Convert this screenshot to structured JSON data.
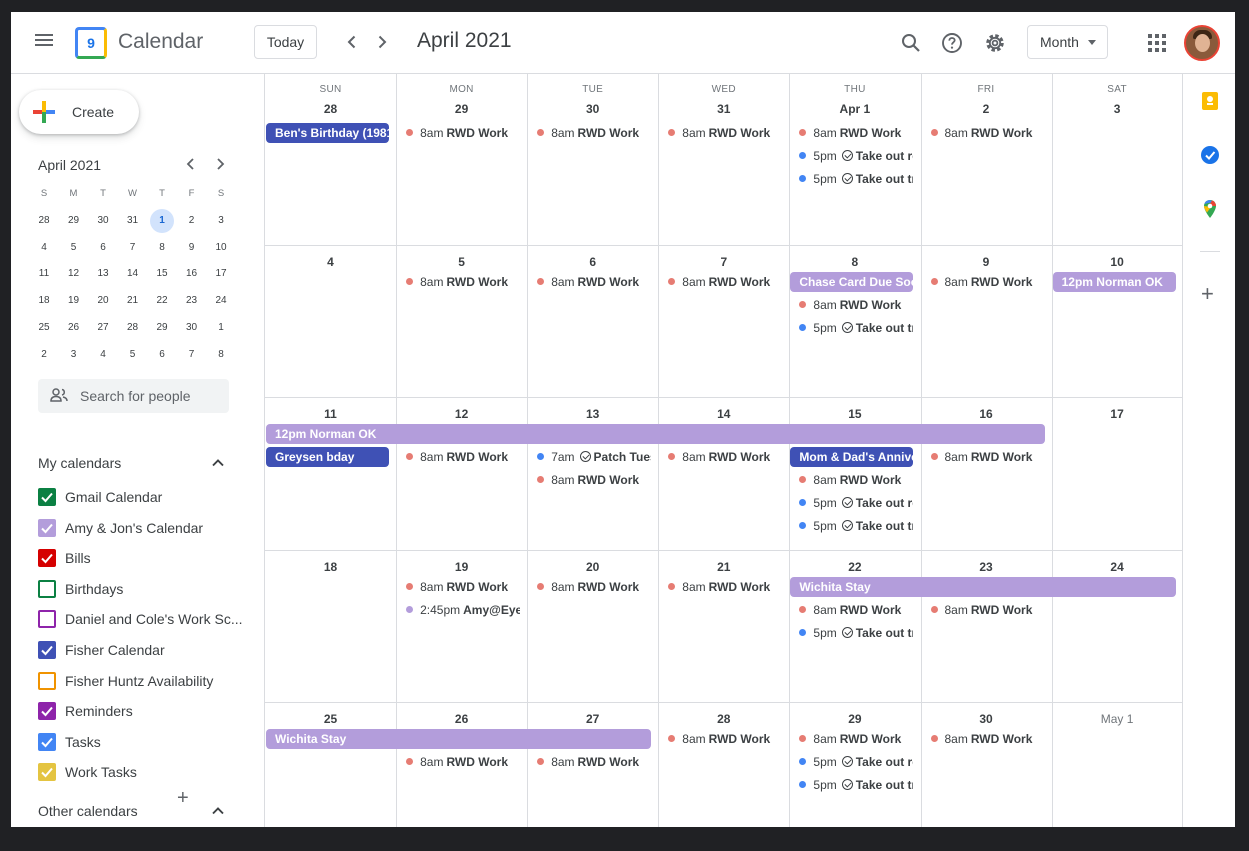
{
  "header": {
    "app_title": "Calendar",
    "logo_number": "9",
    "today_label": "Today",
    "month_title": "April 2021",
    "view_label": "Month",
    "prev_icon": "chevron-left-icon",
    "next_icon": "chevron-right-icon"
  },
  "sidebar": {
    "create_label": "Create",
    "mini_month": "April 2021",
    "mini_dow": [
      "S",
      "M",
      "T",
      "W",
      "T",
      "F",
      "S"
    ],
    "mini_days": [
      "28",
      "29",
      "30",
      "31",
      "1",
      "2",
      "3",
      "4",
      "5",
      "6",
      "7",
      "8",
      "9",
      "10",
      "11",
      "12",
      "13",
      "14",
      "15",
      "16",
      "17",
      "18",
      "19",
      "20",
      "21",
      "22",
      "23",
      "24",
      "25",
      "26",
      "27",
      "28",
      "29",
      "30",
      "1",
      "2",
      "3",
      "4",
      "5",
      "6",
      "7",
      "8"
    ],
    "search_placeholder": "Search for people",
    "my_calendars_title": "My calendars",
    "my_calendars": [
      {
        "name": "Gmail Calendar",
        "color": "#0b8043",
        "checked": true
      },
      {
        "name": "Amy & Jon's Calendar",
        "color": "#b39ddb",
        "checked": true
      },
      {
        "name": "Bills",
        "color": "#d50000",
        "checked": true
      },
      {
        "name": "Birthdays",
        "color": "#0b8043",
        "checked": false
      },
      {
        "name": "Daniel and Cole's Work Sc...",
        "color": "#8e24aa",
        "checked": false
      },
      {
        "name": "Fisher Calendar",
        "color": "#3f51b5",
        "checked": true
      },
      {
        "name": "Fisher Huntz Availability",
        "color": "#f09300",
        "checked": false
      },
      {
        "name": "Reminders",
        "color": "#8e24aa",
        "checked": true
      },
      {
        "name": "Tasks",
        "color": "#4285f4",
        "checked": true
      },
      {
        "name": "Work Tasks",
        "color": "#e4c441",
        "checked": true
      }
    ],
    "other_calendars_title": "Other calendars"
  },
  "grid": {
    "dow": [
      "SUN",
      "MON",
      "TUE",
      "WED",
      "THU",
      "FRI",
      "SAT"
    ],
    "weeks": [
      [
        "28",
        "29",
        "30",
        "31",
        "Apr 1",
        "2",
        "3"
      ],
      [
        "4",
        "5",
        "6",
        "7",
        "8",
        "9",
        "10"
      ],
      [
        "11",
        "12",
        "13",
        "14",
        "15",
        "16",
        "17"
      ],
      [
        "18",
        "19",
        "20",
        "21",
        "22",
        "23",
        "24"
      ],
      [
        "25",
        "26",
        "27",
        "28",
        "29",
        "30",
        "May 1"
      ]
    ],
    "colors": {
      "work": "#e67c73",
      "task": "#4285f4",
      "amy": "#b39ddb",
      "dark": "#3f51b5",
      "lilac": "#b39ddb"
    },
    "chips": [
      {
        "week": 0,
        "start": 0,
        "span": 1,
        "slot": 0,
        "style": "dark",
        "label": "Ben's Birthday (1981"
      },
      {
        "week": 1,
        "start": 4,
        "span": 1,
        "slot": 0,
        "style": "lilac",
        "label": "Chase Card Due Soon"
      },
      {
        "week": 1,
        "start": 6,
        "span": 1,
        "slot": 0,
        "style": "lilac",
        "label": "12pm Norman OK"
      },
      {
        "week": 2,
        "start": 0,
        "span": 6,
        "slot": 0,
        "style": "lilac",
        "label": "12pm Norman OK"
      },
      {
        "week": 2,
        "start": 0,
        "span": 1,
        "slot": 1,
        "style": "dark",
        "label": "Greysen bday"
      },
      {
        "week": 2,
        "start": 4,
        "span": 1,
        "slot": 1,
        "style": "dark",
        "label": "Mom & Dad's Anniversary"
      },
      {
        "week": 3,
        "start": 4,
        "span": 3,
        "slot": 0,
        "style": "lilac",
        "label": "Wichita Stay"
      },
      {
        "week": 4,
        "start": 0,
        "span": 3,
        "slot": 0,
        "style": "lilac",
        "label": "Wichita Stay"
      }
    ],
    "events": [
      {
        "week": 0,
        "day": 1,
        "slot": 0,
        "color": "work",
        "time": "8am",
        "title": "RWD Work"
      },
      {
        "week": 0,
        "day": 2,
        "slot": 0,
        "color": "work",
        "time": "8am",
        "title": "RWD Work"
      },
      {
        "week": 0,
        "day": 3,
        "slot": 0,
        "color": "work",
        "time": "8am",
        "title": "RWD Work"
      },
      {
        "week": 0,
        "day": 4,
        "slot": 0,
        "color": "work",
        "time": "8am",
        "title": "RWD Work"
      },
      {
        "week": 0,
        "day": 4,
        "slot": 1,
        "color": "task",
        "time": "5pm",
        "task": true,
        "title": "Take out recycling"
      },
      {
        "week": 0,
        "day": 4,
        "slot": 2,
        "color": "task",
        "time": "5pm",
        "task": true,
        "title": "Take out trash"
      },
      {
        "week": 0,
        "day": 5,
        "slot": 0,
        "color": "work",
        "time": "8am",
        "title": "RWD Work"
      },
      {
        "week": 1,
        "day": 1,
        "slot": 0,
        "color": "work",
        "time": "8am",
        "title": "RWD Work"
      },
      {
        "week": 1,
        "day": 2,
        "slot": 0,
        "color": "work",
        "time": "8am",
        "title": "RWD Work"
      },
      {
        "week": 1,
        "day": 3,
        "slot": 0,
        "color": "work",
        "time": "8am",
        "title": "RWD Work"
      },
      {
        "week": 1,
        "day": 4,
        "slot": 1,
        "color": "work",
        "time": "8am",
        "title": "RWD Work"
      },
      {
        "week": 1,
        "day": 4,
        "slot": 2,
        "color": "task",
        "time": "5pm",
        "task": true,
        "title": "Take out trash"
      },
      {
        "week": 1,
        "day": 5,
        "slot": 0,
        "color": "work",
        "time": "8am",
        "title": "RWD Work"
      },
      {
        "week": 2,
        "day": 1,
        "slot": 1,
        "color": "work",
        "time": "8am",
        "title": "RWD Work"
      },
      {
        "week": 2,
        "day": 2,
        "slot": 1,
        "color": "task",
        "time": "7am",
        "task": true,
        "title": "Patch Tuesday"
      },
      {
        "week": 2,
        "day": 2,
        "slot": 2,
        "color": "work",
        "time": "8am",
        "title": "RWD Work"
      },
      {
        "week": 2,
        "day": 3,
        "slot": 1,
        "color": "work",
        "time": "8am",
        "title": "RWD Work"
      },
      {
        "week": 2,
        "day": 4,
        "slot": 2,
        "color": "work",
        "time": "8am",
        "title": "RWD Work"
      },
      {
        "week": 2,
        "day": 4,
        "slot": 3,
        "color": "task",
        "time": "5pm",
        "task": true,
        "title": "Take out recycling"
      },
      {
        "week": 2,
        "day": 4,
        "slot": 4,
        "color": "task",
        "time": "5pm",
        "task": true,
        "title": "Take out trash"
      },
      {
        "week": 2,
        "day": 5,
        "slot": 1,
        "color": "work",
        "time": "8am",
        "title": "RWD Work"
      },
      {
        "week": 3,
        "day": 1,
        "slot": 0,
        "color": "work",
        "time": "8am",
        "title": "RWD Work"
      },
      {
        "week": 3,
        "day": 1,
        "slot": 1,
        "color": "amy",
        "time": "2:45pm",
        "title": "Amy@EyeDoctor"
      },
      {
        "week": 3,
        "day": 2,
        "slot": 0,
        "color": "work",
        "time": "8am",
        "title": "RWD Work"
      },
      {
        "week": 3,
        "day": 3,
        "slot": 0,
        "color": "work",
        "time": "8am",
        "title": "RWD Work"
      },
      {
        "week": 3,
        "day": 4,
        "slot": 1,
        "color": "work",
        "time": "8am",
        "title": "RWD Work"
      },
      {
        "week": 3,
        "day": 4,
        "slot": 2,
        "color": "task",
        "time": "5pm",
        "task": true,
        "title": "Take out trash"
      },
      {
        "week": 3,
        "day": 5,
        "slot": 1,
        "color": "work",
        "time": "8am",
        "title": "RWD Work"
      },
      {
        "week": 4,
        "day": 1,
        "slot": 1,
        "color": "work",
        "time": "8am",
        "title": "RWD Work"
      },
      {
        "week": 4,
        "day": 2,
        "slot": 1,
        "color": "work",
        "time": "8am",
        "title": "RWD Work"
      },
      {
        "week": 4,
        "day": 3,
        "slot": 0,
        "color": "work",
        "time": "8am",
        "title": "RWD Work"
      },
      {
        "week": 4,
        "day": 4,
        "slot": 0,
        "color": "work",
        "time": "8am",
        "title": "RWD Work"
      },
      {
        "week": 4,
        "day": 4,
        "slot": 1,
        "color": "task",
        "time": "5pm",
        "task": true,
        "title": "Take out recycling"
      },
      {
        "week": 4,
        "day": 4,
        "slot": 2,
        "color": "task",
        "time": "5pm",
        "task": true,
        "title": "Take out trash"
      },
      {
        "week": 4,
        "day": 5,
        "slot": 0,
        "color": "work",
        "time": "8am",
        "title": "RWD Work"
      }
    ]
  },
  "rail": {
    "icons": [
      "keep-icon",
      "tasks-icon",
      "maps-icon"
    ]
  }
}
